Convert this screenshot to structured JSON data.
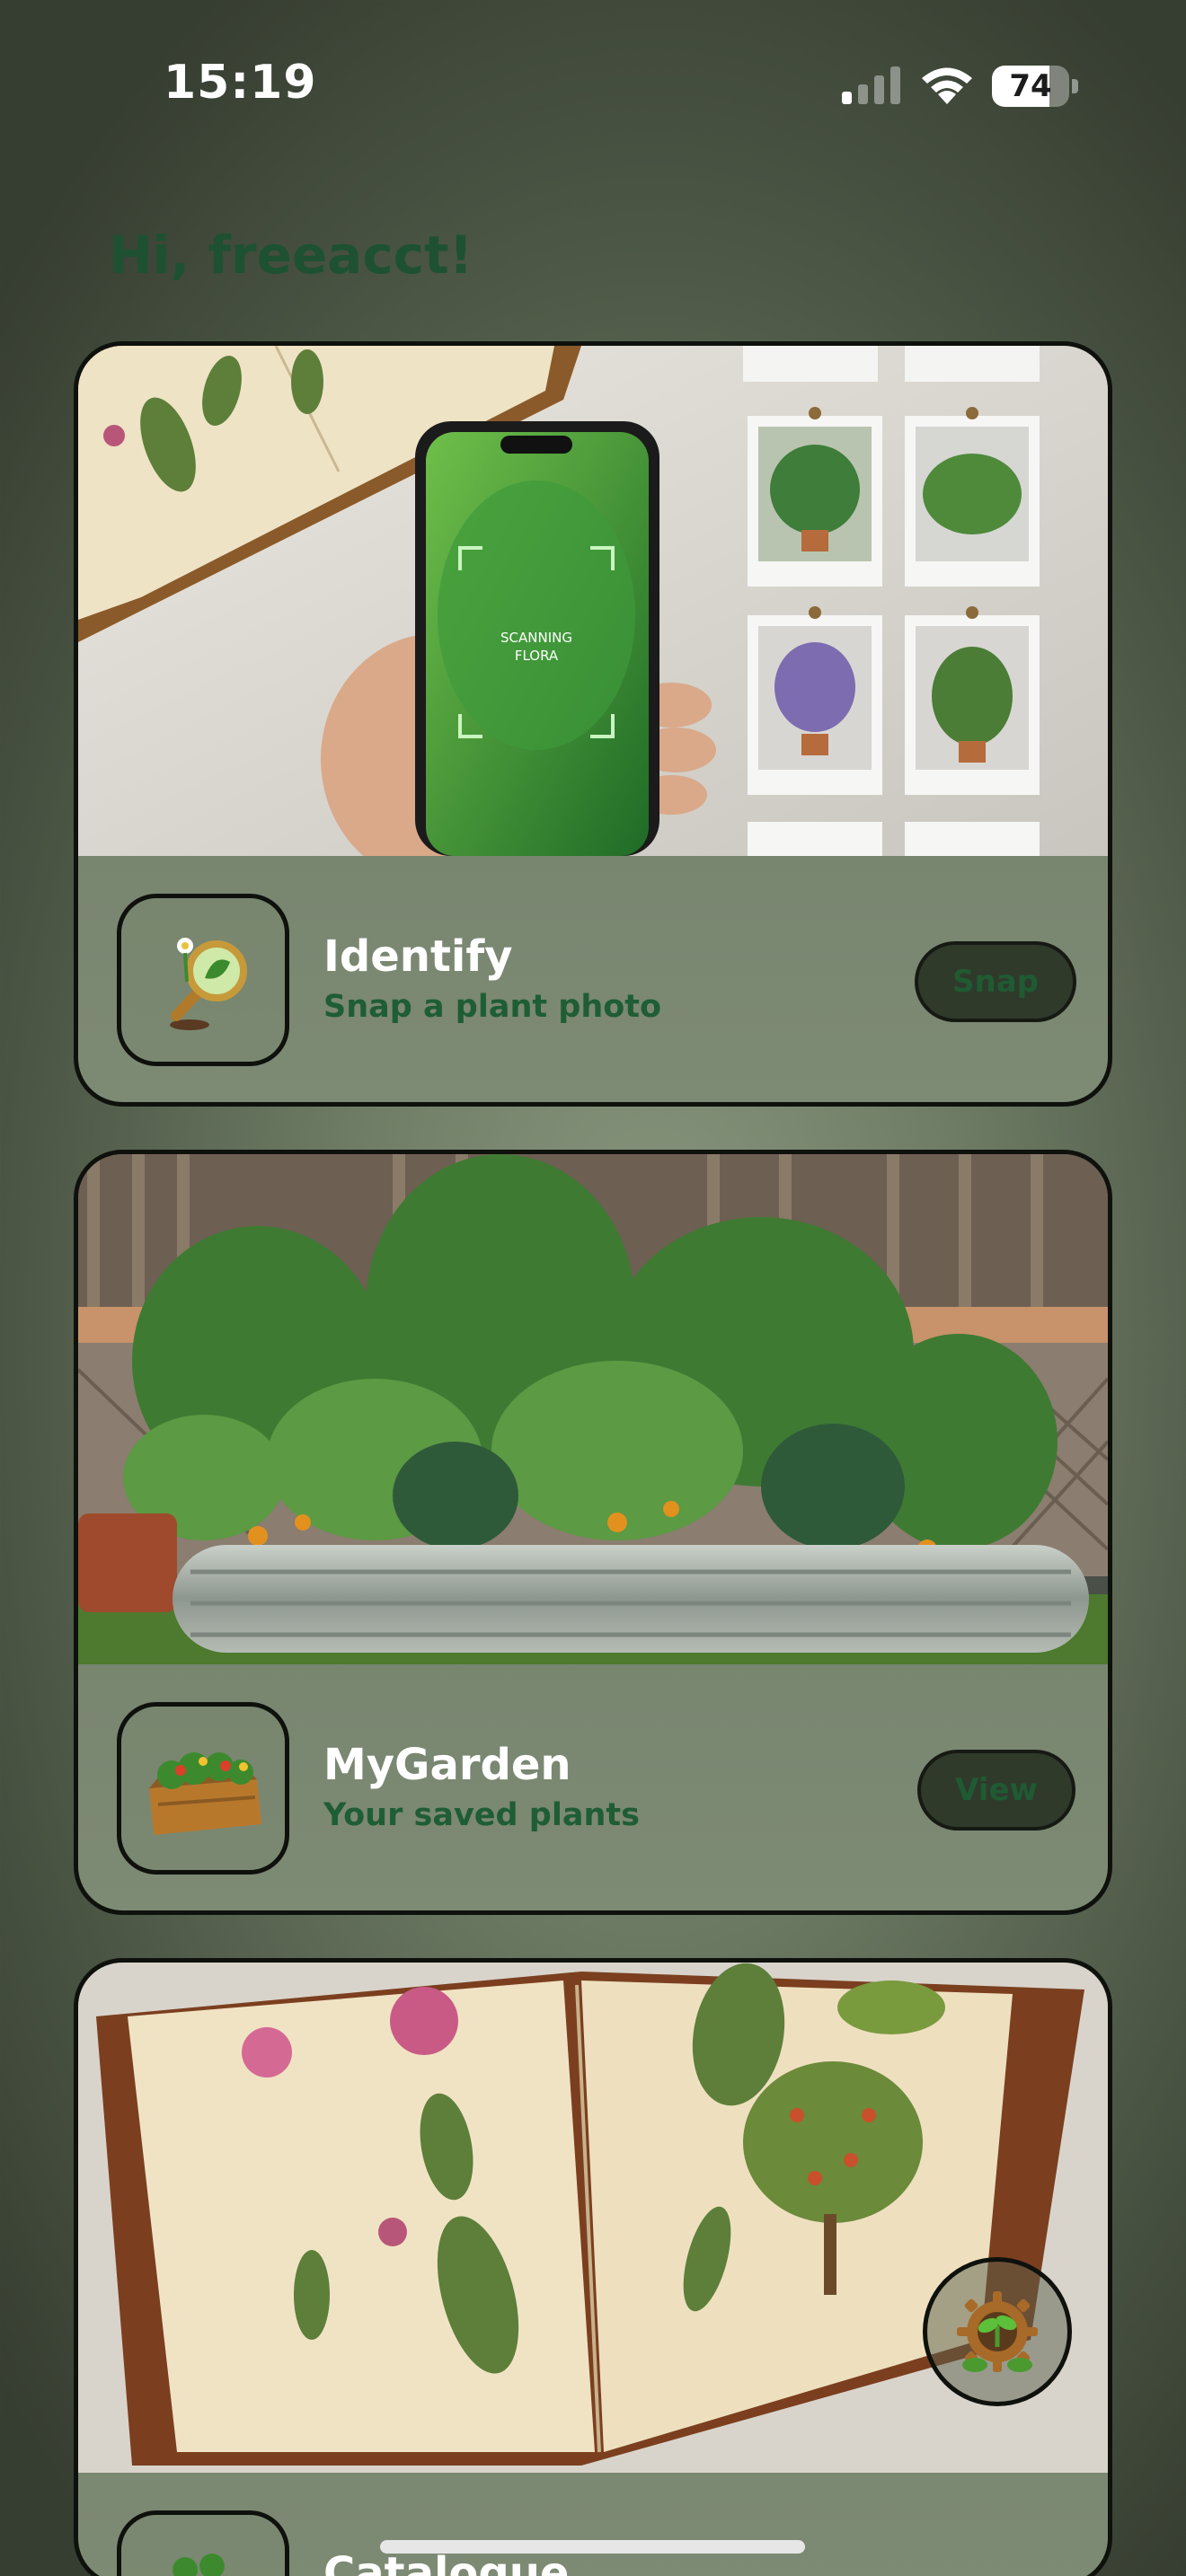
{
  "status_bar": {
    "time": "15:19",
    "battery_level": 74,
    "battery_text": "74"
  },
  "greeting": "Hi, freeacct!",
  "cards": [
    {
      "title": "Identify",
      "subtitle": "Snap a plant photo",
      "button": "Snap",
      "icon": "magnifying-glass-plant-icon",
      "image": "phone-scanning-plant-photo",
      "scan_text": "SCANNING FLORA"
    },
    {
      "title": "MyGarden",
      "subtitle": "Your saved plants",
      "button": "View",
      "icon": "garden-planter-icon",
      "image": "raised-garden-bed-photo"
    },
    {
      "title": "Catalogue",
      "subtitle": "",
      "button": "",
      "icon": "book-plant-icon",
      "image": "botanical-book-photo"
    }
  ],
  "fab": {
    "icon": "gear-plant-icon"
  },
  "colors": {
    "accent": "#1d5131",
    "card_border": "#0e110c",
    "button_bg": "#2f3a2b"
  }
}
